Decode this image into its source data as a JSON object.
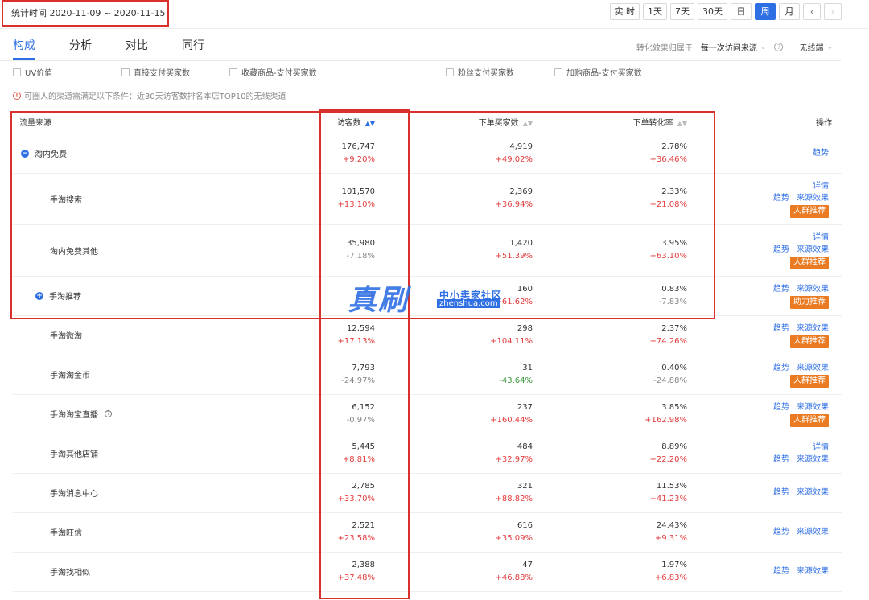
{
  "header": {
    "date_range": "统计时间 2020-11-09 ~ 2020-11-15",
    "periods": [
      "实 时",
      "1天",
      "7天",
      "30天",
      "日",
      "周",
      "月"
    ],
    "active_period": "周",
    "prev_label": "‹",
    "next_label": "›"
  },
  "tabs": [
    "构成",
    "分析",
    "对比",
    "同行"
  ],
  "attribution": {
    "label": "转化效果归属于",
    "value": "每一次访问来源",
    "help": "?",
    "device": "无线端"
  },
  "metrics": [
    "UV价值",
    "直接支付买家数",
    "收藏商品-支付买家数",
    "粉丝支付买家数",
    "加购商品-支付买家数"
  ],
  "notice": {
    "icon": "!",
    "text": "可圈人的渠道需满足以下条件：近30天访客数排名本店TOP10的无线渠道"
  },
  "table": {
    "headers": {
      "source": "流量来源",
      "visitors": "访客数",
      "buyers": "下单买家数",
      "rate": "下单转化率",
      "op": "操作"
    },
    "rows": [
      {
        "name": "淘内免费",
        "expand": "−",
        "info": "",
        "visitors": "176,747",
        "visitors_chg": "+9.20%",
        "buyers": "4,919",
        "buyers_chg": "+49.02%",
        "rate": "2.78%",
        "rate_chg": "+36.46%",
        "ops_top": [],
        "ops": [
          "趋势"
        ],
        "badge": ""
      },
      {
        "name": "手淘搜索",
        "expand": "",
        "info": "",
        "visitors": "101,570",
        "visitors_chg": "+13.10%",
        "buyers": "2,369",
        "buyers_chg": "+36.94%",
        "rate": "2.33%",
        "rate_chg": "+21.08%",
        "ops_top": [
          "详情"
        ],
        "ops": [
          "趋势",
          "来源效果"
        ],
        "badge": "人群推荐"
      },
      {
        "name": "淘内免费其他",
        "expand": "",
        "info": "",
        "visitors": "35,980",
        "visitors_chg": "-7.18%",
        "buyers": "1,420",
        "buyers_chg": "+51.39%",
        "rate": "3.95%",
        "rate_chg": "+63.10%",
        "ops_top": [
          "详情"
        ],
        "ops": [
          "趋势",
          "来源效果"
        ],
        "badge": "人群推荐"
      },
      {
        "name": "手淘推荐",
        "expand": "+",
        "info": "",
        "visitors": "",
        "visitors_chg": "+",
        "buyers": "160",
        "buyers_chg": "+61.62%",
        "rate": "0.83%",
        "rate_chg": "-7.83%",
        "ops_top": [],
        "ops": [
          "趋势",
          "来源效果"
        ],
        "badge": "助力推荐"
      },
      {
        "name": "手淘微淘",
        "expand": "",
        "info": "",
        "visitors": "12,594",
        "visitors_chg": "+17.13%",
        "buyers": "298",
        "buyers_chg": "+104.11%",
        "rate": "2.37%",
        "rate_chg": "+74.26%",
        "ops_top": [],
        "ops": [
          "趋势",
          "来源效果"
        ],
        "badge": "人群推荐"
      },
      {
        "name": "手淘淘金币",
        "expand": "",
        "info": "",
        "visitors": "7,793",
        "visitors_chg": "-24.97%",
        "buyers": "31",
        "buyers_chg": "-43.64%",
        "rate": "0.40%",
        "rate_chg": "-24.88%",
        "ops_top": [],
        "ops": [
          "趋势",
          "来源效果"
        ],
        "badge": "人群推荐"
      },
      {
        "name": "手淘淘宝直播",
        "expand": "",
        "info": "?",
        "visitors": "6,152",
        "visitors_chg": "-0.97%",
        "buyers": "237",
        "buyers_chg": "+160.44%",
        "rate": "3.85%",
        "rate_chg": "+162.98%",
        "ops_top": [],
        "ops": [
          "趋势",
          "来源效果"
        ],
        "badge": "人群推荐"
      },
      {
        "name": "手淘其他店铺",
        "expand": "",
        "info": "",
        "visitors": "5,445",
        "visitors_chg": "+8.81%",
        "buyers": "484",
        "buyers_chg": "+32.97%",
        "rate": "8.89%",
        "rate_chg": "+22.20%",
        "ops_top": [
          "详情"
        ],
        "ops": [
          "趋势",
          "来源效果"
        ],
        "badge": ""
      },
      {
        "name": "手淘消息中心",
        "expand": "",
        "info": "",
        "visitors": "2,785",
        "visitors_chg": "+33.70%",
        "buyers": "321",
        "buyers_chg": "+88.82%",
        "rate": "11.53%",
        "rate_chg": "+41.23%",
        "ops_top": [],
        "ops": [
          "趋势",
          "来源效果"
        ],
        "badge": ""
      },
      {
        "name": "手淘旺信",
        "expand": "",
        "info": "",
        "visitors": "2,521",
        "visitors_chg": "+23.58%",
        "buyers": "616",
        "buyers_chg": "+35.09%",
        "rate": "24.43%",
        "rate_chg": "+9.31%",
        "ops_top": [],
        "ops": [
          "趋势",
          "来源效果"
        ],
        "badge": ""
      },
      {
        "name": "手淘找相似",
        "expand": "",
        "info": "",
        "visitors": "2,388",
        "visitors_chg": "+37.48%",
        "buyers": "47",
        "buyers_chg": "+46.88%",
        "rate": "1.97%",
        "rate_chg": "+6.83%",
        "ops_top": [],
        "ops": [
          "趋势",
          "来源效果"
        ],
        "badge": ""
      }
    ]
  },
  "watermark": {
    "main": "真刷",
    "sub": "中小卖家社区",
    "domain": "zhenshua.com"
  },
  "colors": {
    "accent": "#2f6fe4",
    "increase": "#e23c3c",
    "decrease_green": "#3c9a3c",
    "badge": "#ea7b22",
    "highlight_box": "#d9302b"
  }
}
